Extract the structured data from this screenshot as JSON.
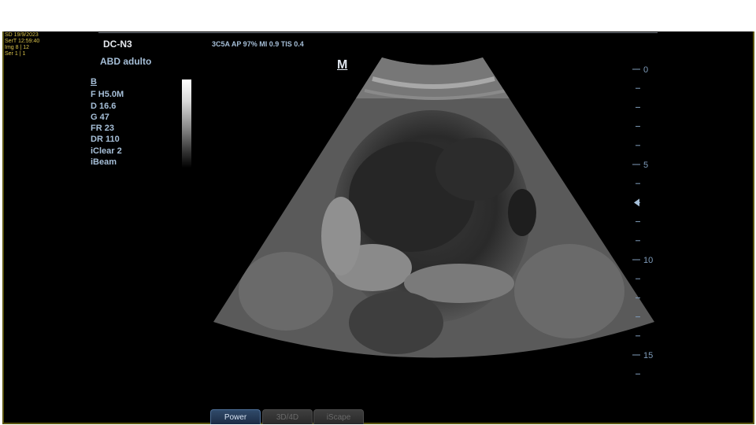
{
  "corner_info": {
    "date": "SD 19/9/2023",
    "time": "SerT 12:59:40",
    "image": "Img 8 | 12",
    "series": "Ser 1 | 1"
  },
  "header": {
    "title": "DC-N3",
    "probe_info": "3C5A  AP 97%  MI 0.9  TIS 0.4"
  },
  "preset": "ABD adulto",
  "imaging_params": {
    "mode": "B",
    "items": [
      "F H5.0M",
      "D 16.6",
      "G 47",
      "FR 23",
      "DR 110",
      "iClear 2",
      "iBeam"
    ]
  },
  "orientation_mark": "M",
  "depth_scale": {
    "labels": [
      "0",
      "5",
      "10",
      "15"
    ],
    "focus_depth_cm": 7
  },
  "tabs": [
    {
      "label": "Power",
      "active": true
    },
    {
      "label": "3D/4D",
      "active": false
    },
    {
      "label": "iScape",
      "active": false
    }
  ],
  "colors": {
    "text_blue": "#a6bfd8",
    "corner_yellow": "#d8c24a",
    "background": "#000000"
  }
}
